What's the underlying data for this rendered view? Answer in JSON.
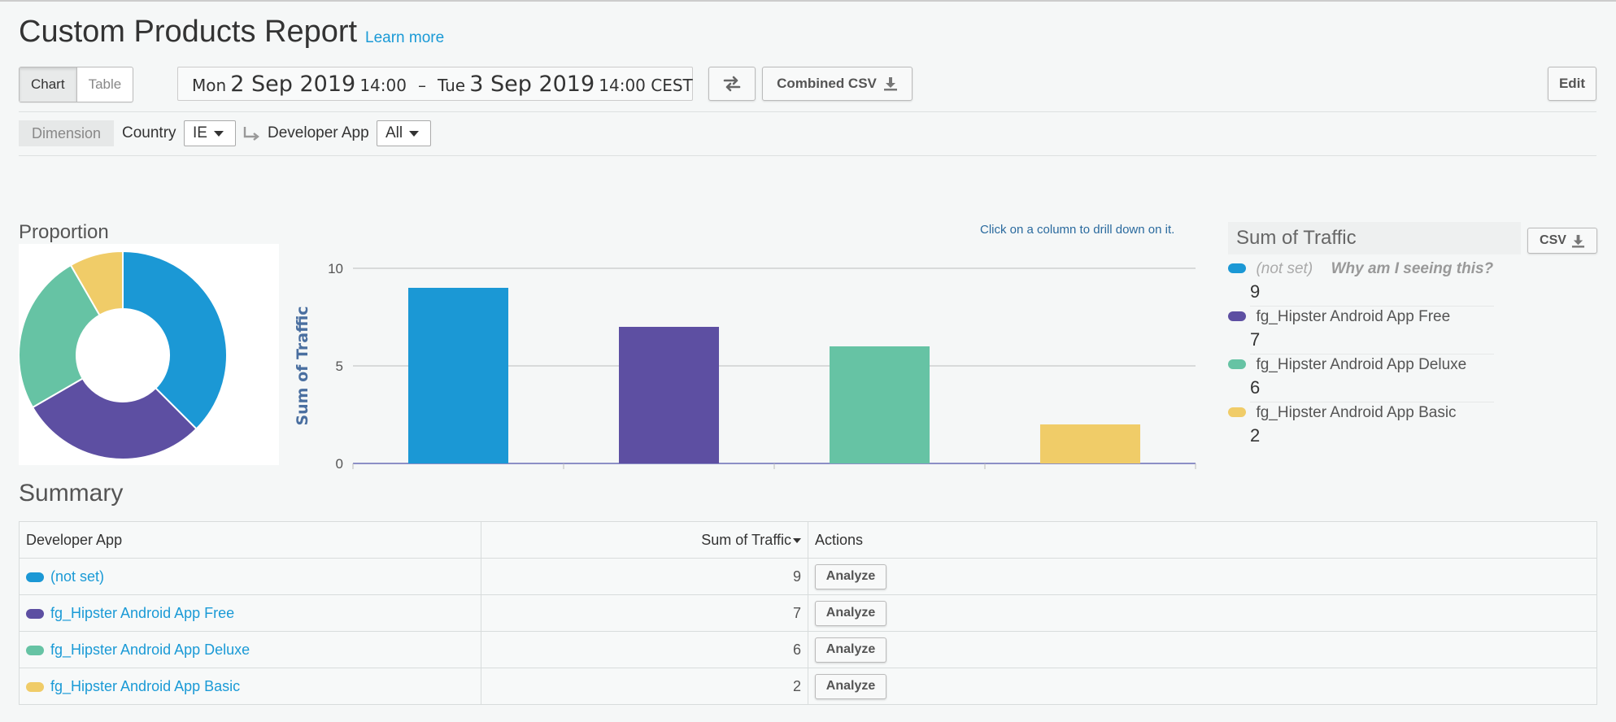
{
  "header": {
    "title": "Custom Products Report",
    "learn_more": "Learn more",
    "view_toggle": {
      "chart": "Chart",
      "table": "Table",
      "selected": "Chart"
    },
    "date_range": {
      "start_day": "Mon",
      "start_date": "2 Sep 2019",
      "start_time": "14:00",
      "separator": "–",
      "end_day": "Tue",
      "end_date": "3 Sep 2019",
      "end_time": "14:00 CEST"
    },
    "combined_csv": "Combined CSV",
    "edit": "Edit"
  },
  "filters": {
    "dimension_label": "Dimension",
    "country_label": "Country",
    "country_value": "IE",
    "developer_app_label": "Developer App",
    "developer_app_value": "All"
  },
  "proportion": {
    "title": "Proportion"
  },
  "chart_hint": "Click on a column to drill down on it.",
  "legend": {
    "title": "Sum of Traffic",
    "csv": "CSV",
    "why": "Why am I seeing this?"
  },
  "colors": {
    "not_set": "#1b98d5",
    "free": "#5d4fa2",
    "deluxe": "#66c3a4",
    "basic": "#f0cc68",
    "link": "#1a9ad6"
  },
  "chart_data": [
    {
      "type": "pie",
      "categories": [
        "(not set)",
        "fg_Hipster Android App Free",
        "fg_Hipster Android App Deluxe",
        "fg_Hipster Android App Basic"
      ],
      "values": [
        9,
        7,
        6,
        2
      ],
      "colors": [
        "#1b98d5",
        "#5d4fa2",
        "#66c3a4",
        "#f0cc68"
      ],
      "donut": true,
      "title": "Proportion"
    },
    {
      "type": "bar",
      "categories": [
        "(not set)",
        "fg_Hipster Android App Free",
        "fg_Hipster Android App Deluxe",
        "fg_Hipster Android App Basic"
      ],
      "values": [
        9,
        7,
        6,
        2
      ],
      "colors": [
        "#1b98d5",
        "#5d4fa2",
        "#66c3a4",
        "#f0cc68"
      ],
      "ylabel": "Sum of Traffic",
      "yticks": [
        0,
        5,
        10
      ],
      "ylim": [
        0,
        10
      ],
      "grid": true
    }
  ],
  "summary": {
    "title": "Summary",
    "columns": [
      "Developer App",
      "Sum of Traffic",
      "Actions"
    ],
    "rows": [
      {
        "app": "(not set)",
        "traffic": "9",
        "action": "Analyze",
        "color": "#1b98d5"
      },
      {
        "app": "fg_Hipster Android App Free",
        "traffic": "7",
        "action": "Analyze",
        "color": "#5d4fa2"
      },
      {
        "app": "fg_Hipster Android App Deluxe",
        "traffic": "6",
        "action": "Analyze",
        "color": "#66c3a4"
      },
      {
        "app": "fg_Hipster Android App Basic",
        "traffic": "2",
        "action": "Analyze",
        "color": "#f0cc68"
      }
    ]
  }
}
